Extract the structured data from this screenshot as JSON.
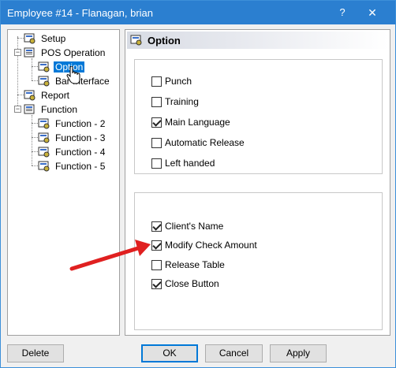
{
  "window": {
    "title": "Employee #14 - Flanagan, brian",
    "help_glyph": "?",
    "close_glyph": "✕"
  },
  "tree": {
    "items": [
      {
        "label": "Setup"
      },
      {
        "label": "POS Operation"
      },
      {
        "label": "Option"
      },
      {
        "label": "Bar Interface"
      },
      {
        "label": "Report"
      },
      {
        "label": "Function"
      },
      {
        "label": "Function - 2"
      },
      {
        "label": "Function - 3"
      },
      {
        "label": "Function - 4"
      },
      {
        "label": "Function - 5"
      }
    ]
  },
  "panel": {
    "title": "Option",
    "group1": [
      {
        "label": "Punch",
        "checked": false
      },
      {
        "label": "Training",
        "checked": false
      },
      {
        "label": "Main Language",
        "checked": true
      },
      {
        "label": "Automatic Release",
        "checked": false
      },
      {
        "label": "Left handed",
        "checked": false
      }
    ],
    "group2": [
      {
        "label": "Client's Name",
        "checked": true
      },
      {
        "label": "Modify Check Amount",
        "checked": true
      },
      {
        "label": "Release Table",
        "checked": false
      },
      {
        "label": "Close Button",
        "checked": true
      }
    ]
  },
  "buttons": {
    "delete": "Delete",
    "ok": "OK",
    "cancel": "Cancel",
    "apply": "Apply"
  },
  "colors": {
    "titlebar": "#2b7fd0",
    "selection": "#0078d7",
    "annotation_arrow": "#e02020"
  }
}
